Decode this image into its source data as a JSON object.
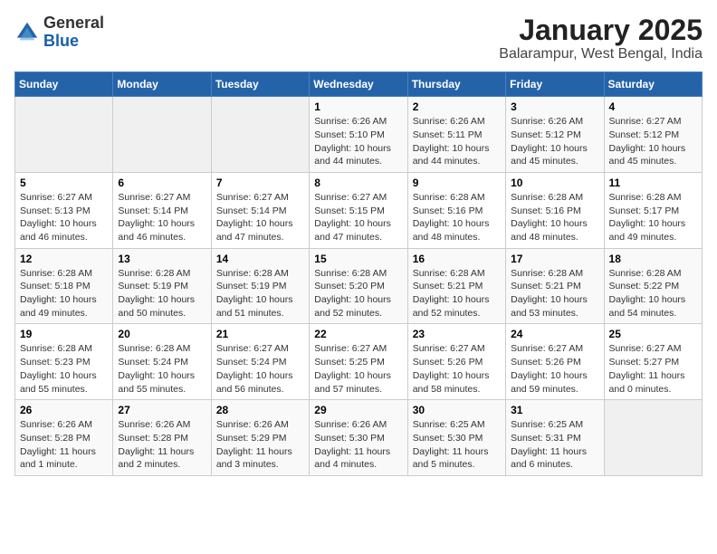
{
  "logo": {
    "general": "General",
    "blue": "Blue"
  },
  "title": "January 2025",
  "subtitle": "Balarampur, West Bengal, India",
  "weekdays": [
    "Sunday",
    "Monday",
    "Tuesday",
    "Wednesday",
    "Thursday",
    "Friday",
    "Saturday"
  ],
  "weeks": [
    [
      {
        "day": "",
        "info": ""
      },
      {
        "day": "",
        "info": ""
      },
      {
        "day": "",
        "info": ""
      },
      {
        "day": "1",
        "info": "Sunrise: 6:26 AM\nSunset: 5:10 PM\nDaylight: 10 hours\nand 44 minutes."
      },
      {
        "day": "2",
        "info": "Sunrise: 6:26 AM\nSunset: 5:11 PM\nDaylight: 10 hours\nand 44 minutes."
      },
      {
        "day": "3",
        "info": "Sunrise: 6:26 AM\nSunset: 5:12 PM\nDaylight: 10 hours\nand 45 minutes."
      },
      {
        "day": "4",
        "info": "Sunrise: 6:27 AM\nSunset: 5:12 PM\nDaylight: 10 hours\nand 45 minutes."
      }
    ],
    [
      {
        "day": "5",
        "info": "Sunrise: 6:27 AM\nSunset: 5:13 PM\nDaylight: 10 hours\nand 46 minutes."
      },
      {
        "day": "6",
        "info": "Sunrise: 6:27 AM\nSunset: 5:14 PM\nDaylight: 10 hours\nand 46 minutes."
      },
      {
        "day": "7",
        "info": "Sunrise: 6:27 AM\nSunset: 5:14 PM\nDaylight: 10 hours\nand 47 minutes."
      },
      {
        "day": "8",
        "info": "Sunrise: 6:27 AM\nSunset: 5:15 PM\nDaylight: 10 hours\nand 47 minutes."
      },
      {
        "day": "9",
        "info": "Sunrise: 6:28 AM\nSunset: 5:16 PM\nDaylight: 10 hours\nand 48 minutes."
      },
      {
        "day": "10",
        "info": "Sunrise: 6:28 AM\nSunset: 5:16 PM\nDaylight: 10 hours\nand 48 minutes."
      },
      {
        "day": "11",
        "info": "Sunrise: 6:28 AM\nSunset: 5:17 PM\nDaylight: 10 hours\nand 49 minutes."
      }
    ],
    [
      {
        "day": "12",
        "info": "Sunrise: 6:28 AM\nSunset: 5:18 PM\nDaylight: 10 hours\nand 49 minutes."
      },
      {
        "day": "13",
        "info": "Sunrise: 6:28 AM\nSunset: 5:19 PM\nDaylight: 10 hours\nand 50 minutes."
      },
      {
        "day": "14",
        "info": "Sunrise: 6:28 AM\nSunset: 5:19 PM\nDaylight: 10 hours\nand 51 minutes."
      },
      {
        "day": "15",
        "info": "Sunrise: 6:28 AM\nSunset: 5:20 PM\nDaylight: 10 hours\nand 52 minutes."
      },
      {
        "day": "16",
        "info": "Sunrise: 6:28 AM\nSunset: 5:21 PM\nDaylight: 10 hours\nand 52 minutes."
      },
      {
        "day": "17",
        "info": "Sunrise: 6:28 AM\nSunset: 5:21 PM\nDaylight: 10 hours\nand 53 minutes."
      },
      {
        "day": "18",
        "info": "Sunrise: 6:28 AM\nSunset: 5:22 PM\nDaylight: 10 hours\nand 54 minutes."
      }
    ],
    [
      {
        "day": "19",
        "info": "Sunrise: 6:28 AM\nSunset: 5:23 PM\nDaylight: 10 hours\nand 55 minutes."
      },
      {
        "day": "20",
        "info": "Sunrise: 6:28 AM\nSunset: 5:24 PM\nDaylight: 10 hours\nand 55 minutes."
      },
      {
        "day": "21",
        "info": "Sunrise: 6:27 AM\nSunset: 5:24 PM\nDaylight: 10 hours\nand 56 minutes."
      },
      {
        "day": "22",
        "info": "Sunrise: 6:27 AM\nSunset: 5:25 PM\nDaylight: 10 hours\nand 57 minutes."
      },
      {
        "day": "23",
        "info": "Sunrise: 6:27 AM\nSunset: 5:26 PM\nDaylight: 10 hours\nand 58 minutes."
      },
      {
        "day": "24",
        "info": "Sunrise: 6:27 AM\nSunset: 5:26 PM\nDaylight: 10 hours\nand 59 minutes."
      },
      {
        "day": "25",
        "info": "Sunrise: 6:27 AM\nSunset: 5:27 PM\nDaylight: 11 hours\nand 0 minutes."
      }
    ],
    [
      {
        "day": "26",
        "info": "Sunrise: 6:26 AM\nSunset: 5:28 PM\nDaylight: 11 hours\nand 1 minute."
      },
      {
        "day": "27",
        "info": "Sunrise: 6:26 AM\nSunset: 5:28 PM\nDaylight: 11 hours\nand 2 minutes."
      },
      {
        "day": "28",
        "info": "Sunrise: 6:26 AM\nSunset: 5:29 PM\nDaylight: 11 hours\nand 3 minutes."
      },
      {
        "day": "29",
        "info": "Sunrise: 6:26 AM\nSunset: 5:30 PM\nDaylight: 11 hours\nand 4 minutes."
      },
      {
        "day": "30",
        "info": "Sunrise: 6:25 AM\nSunset: 5:30 PM\nDaylight: 11 hours\nand 5 minutes."
      },
      {
        "day": "31",
        "info": "Sunrise: 6:25 AM\nSunset: 5:31 PM\nDaylight: 11 hours\nand 6 minutes."
      },
      {
        "day": "",
        "info": ""
      }
    ]
  ]
}
